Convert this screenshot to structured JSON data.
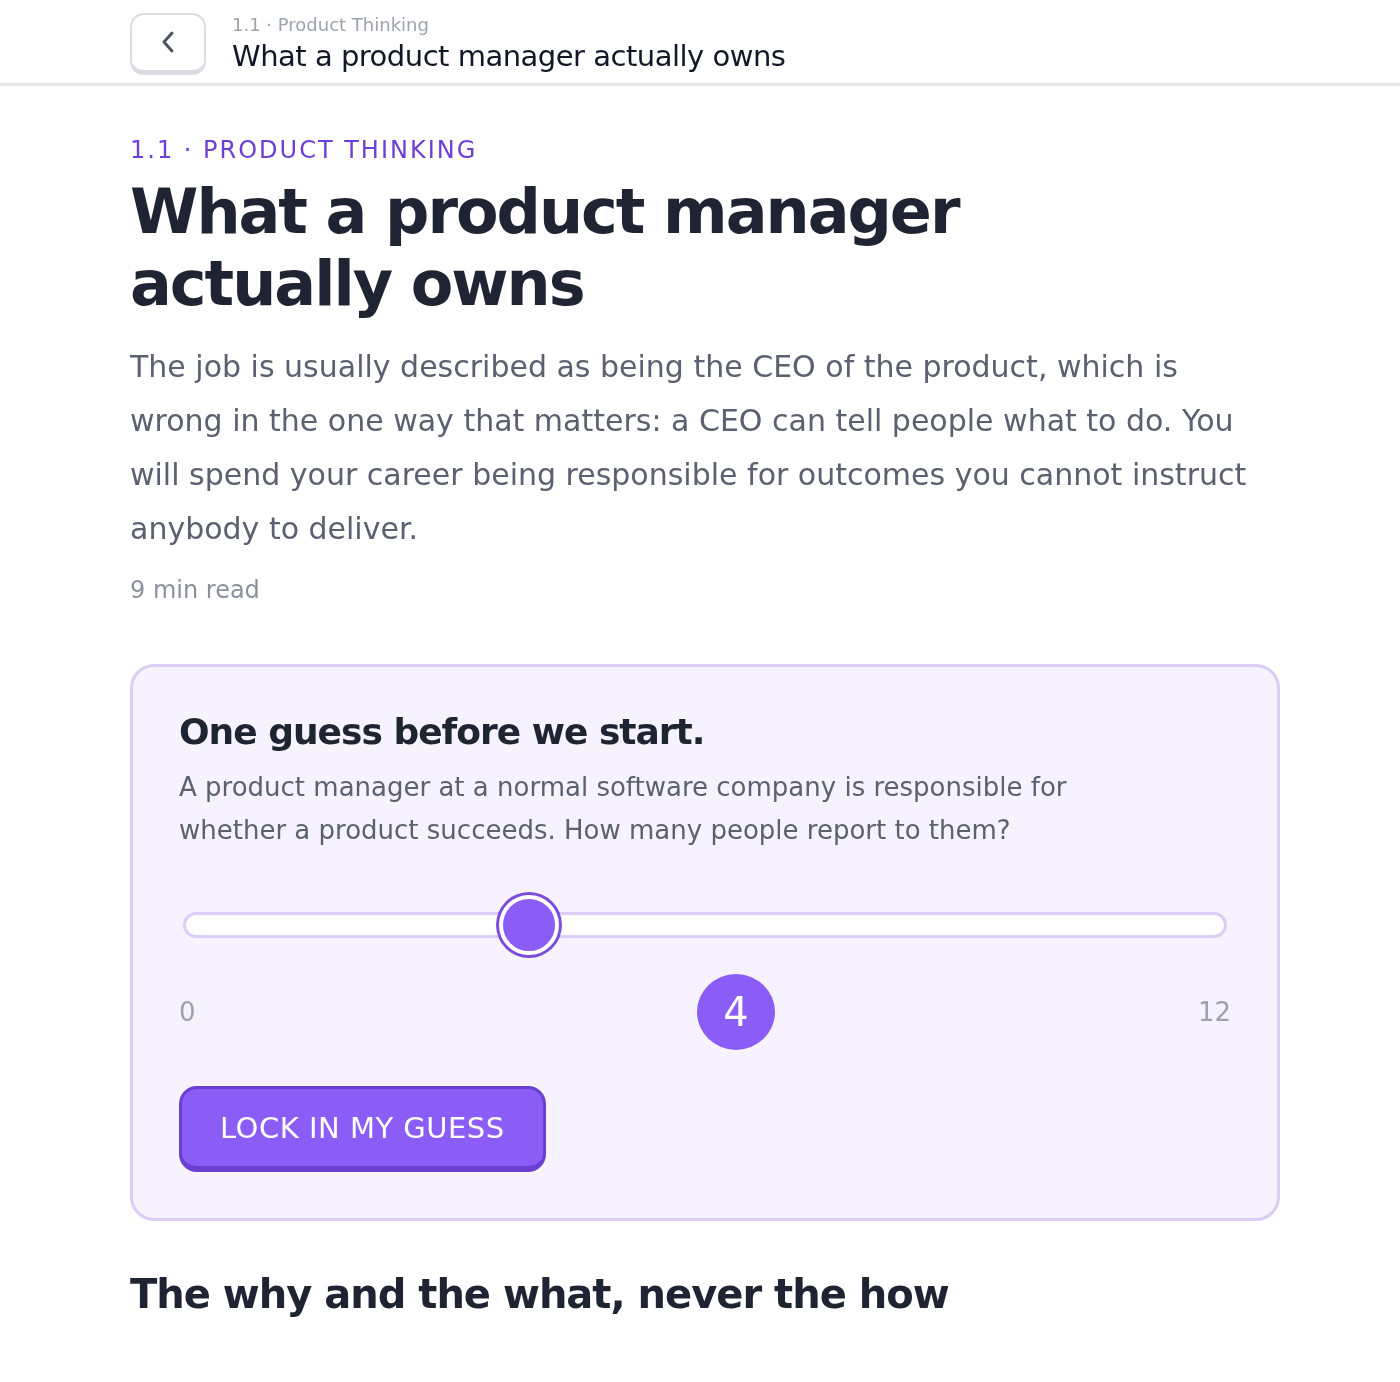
{
  "header": {
    "breadcrumb": "1.1 · Product Thinking",
    "title": "What a product manager actually owns"
  },
  "lesson": {
    "eyebrow": "1.1 · PRODUCT THINKING",
    "title": "What a product manager actually owns",
    "intro": "The job is usually described as being the CEO of the product, which is wrong in the one way that matters: a CEO can tell people what to do. You will spend your career being responsible for outcomes you cannot instruct anybody to deliver.",
    "read_time": "9 min read"
  },
  "guess_card": {
    "title": "One guess before we start.",
    "question": "A product manager at a normal software company is responsible for whether a product succeeds. How many people report to them?",
    "slider": {
      "level": 0.333,
      "min_label": "0",
      "max_label": "12",
      "value": "4"
    },
    "button": "LOCK IN MY GUESS"
  },
  "next_section": {
    "title": "The why and the what, never the how"
  }
}
